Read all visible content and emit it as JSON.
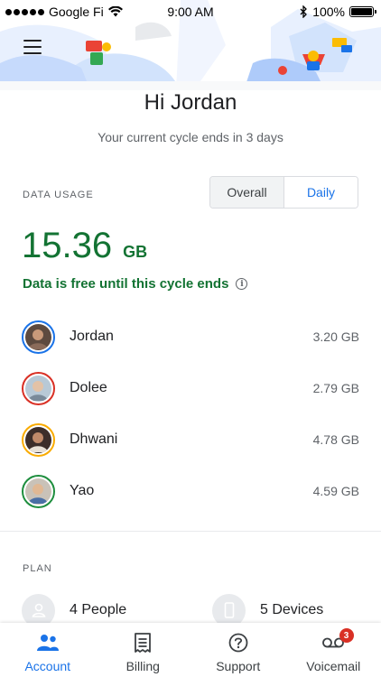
{
  "status_bar": {
    "carrier": "Google Fi",
    "time": "9:00 AM",
    "battery": "100%"
  },
  "header": {
    "greeting": "Hi Jordan",
    "cycle_text": "Your current cycle ends in 3 days"
  },
  "data_usage": {
    "label": "DATA USAGE",
    "toggle": {
      "overall": "Overall",
      "daily": "Daily"
    },
    "amount": "15.36",
    "unit": "GB",
    "free_text": "Data is free until this cycle ends"
  },
  "members": [
    {
      "name": "Jordan",
      "usage": "3.20 GB",
      "ring_color": "#1a73e8"
    },
    {
      "name": "Dolee",
      "usage": "2.79 GB",
      "ring_color": "#d93025"
    },
    {
      "name": "Dhwani",
      "usage": "4.78 GB",
      "ring_color": "#f9ab00"
    },
    {
      "name": "Yao",
      "usage": "4.59 GB",
      "ring_color": "#1e8e3e"
    }
  ],
  "plan": {
    "label": "PLAN",
    "people": "4 People",
    "devices": "5 Devices"
  },
  "tabs": [
    {
      "label": "Account",
      "icon": "account-icon"
    },
    {
      "label": "Billing",
      "icon": "billing-icon"
    },
    {
      "label": "Support",
      "icon": "support-icon"
    },
    {
      "label": "Voicemail",
      "icon": "voicemail-icon",
      "badge": "3"
    }
  ],
  "colors": {
    "accent": "#1a73e8",
    "green": "#137333",
    "badge": "#d93025"
  }
}
